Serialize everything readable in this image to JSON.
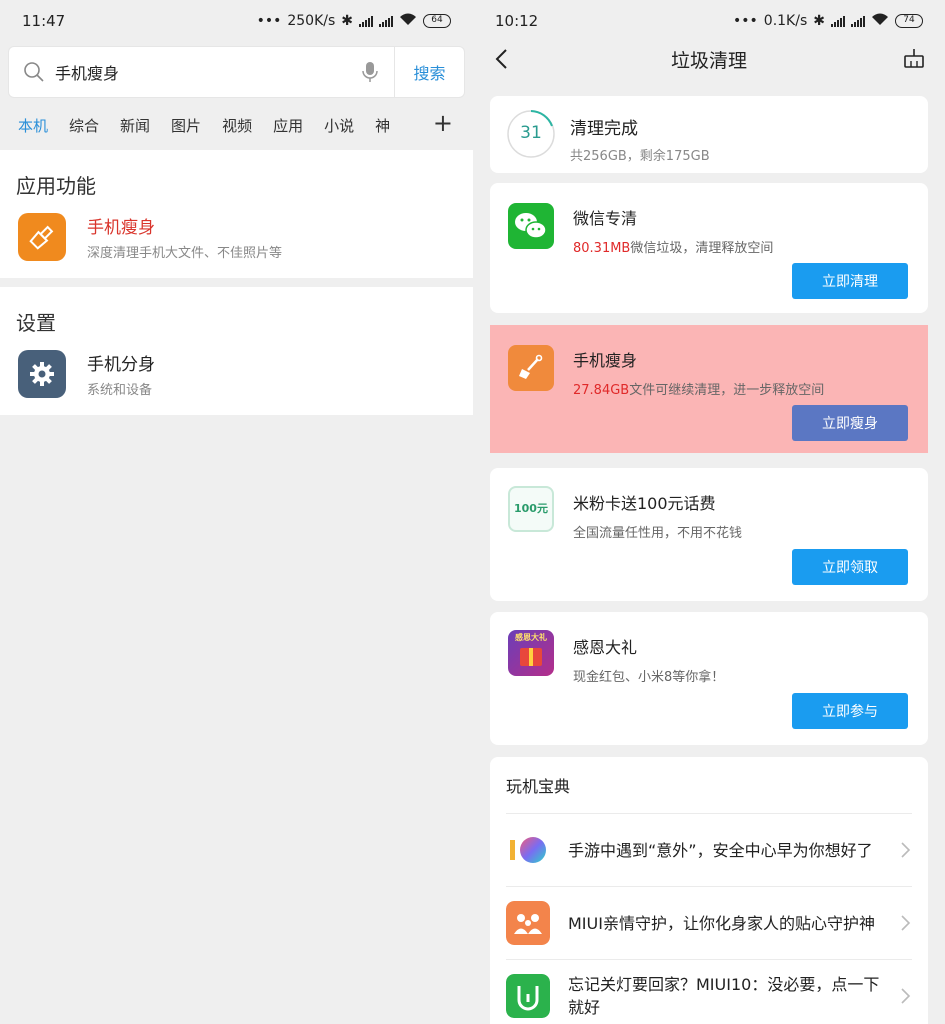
{
  "left": {
    "status": {
      "time": "11:47",
      "speed": "250K/s",
      "battery": "64"
    },
    "search": {
      "query": "手机瘦身",
      "button": "搜索"
    },
    "tabs": [
      "本机",
      "综合",
      "新闻",
      "图片",
      "视频",
      "应用",
      "小说",
      "神"
    ],
    "tab_plus": "+",
    "section_app": {
      "header": "应用功能",
      "item": {
        "title": "手机瘦身",
        "subtitle": "深度清理手机大文件、不佳照片等"
      }
    },
    "section_settings": {
      "header": "设置",
      "item": {
        "title": "手机分身",
        "subtitle": "系统和设备"
      }
    }
  },
  "right": {
    "status": {
      "time": "10:12",
      "speed": "0.1K/s",
      "battery": "74"
    },
    "title": "垃圾清理",
    "summary": {
      "ring": "31",
      "title": "清理完成",
      "subtitle": "共256GB，剩余175GB"
    },
    "cards": [
      {
        "title": "微信专清",
        "highlight": "80.31MB",
        "subtitle": "微信垃圾，清理释放空间",
        "button": "立即清理"
      },
      {
        "title": "手机瘦身",
        "highlight": "27.84GB",
        "subtitle": "文件可继续清理，进一步释放空间",
        "button": "立即瘦身"
      },
      {
        "title": "米粉卡送100元话费",
        "subtitle": "全国流量任性用，不用不花钱",
        "button": "立即领取",
        "icon_text": "100元"
      },
      {
        "title": "感恩大礼",
        "subtitle": "现金红包、小米8等你拿！",
        "button": "立即参与",
        "icon_text": "感恩大礼"
      }
    ],
    "tips": {
      "header": "玩机宝典",
      "items": [
        {
          "text": "手游中遇到“意外”，安全中心早为你想好了"
        },
        {
          "text": "MIUI亲情守护，让你化身家人的贴心守护神"
        },
        {
          "text": "忘记关灯要回家？MIUI10：没必要，点一下就好"
        }
      ]
    }
  }
}
